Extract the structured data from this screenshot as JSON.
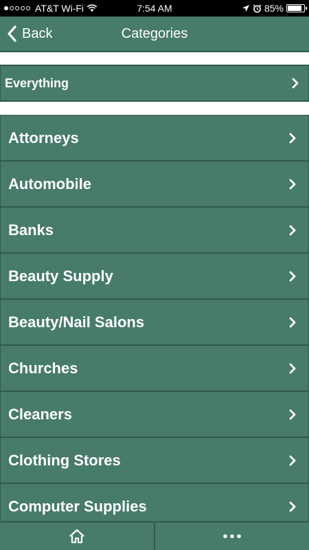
{
  "status_bar": {
    "carrier": "AT&T Wi-Fi",
    "time": "7:54 AM",
    "battery_percent": "85%",
    "battery_level": 0.85,
    "signal_bars_filled": 1,
    "signal_bars_total": 5
  },
  "nav": {
    "back_label": "Back",
    "title": "Categories"
  },
  "everything_label": "Everything",
  "categories": [
    {
      "label": "Attorneys"
    },
    {
      "label": "Automobile"
    },
    {
      "label": "Banks"
    },
    {
      "label": "Beauty Supply"
    },
    {
      "label": "Beauty/Nail Salons"
    },
    {
      "label": "Churches"
    },
    {
      "label": "Cleaners"
    },
    {
      "label": "Clothing Stores"
    },
    {
      "label": "Computer Supplies"
    }
  ],
  "tab_bar": {
    "tabs": [
      {
        "icon": "home-icon"
      },
      {
        "icon": "more-icon"
      }
    ]
  },
  "colors": {
    "accent": "#477b6b",
    "border": "#2f5a4c"
  }
}
